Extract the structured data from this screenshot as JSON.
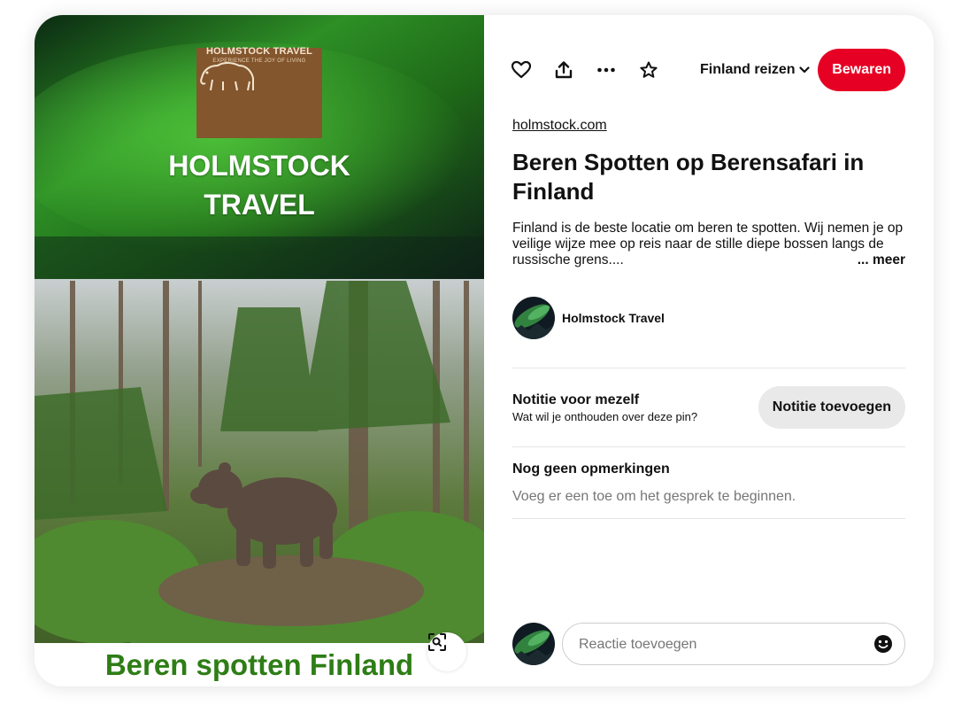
{
  "image": {
    "logo_text": "HOLMSTOCK TRAVEL",
    "logo_tagline": "EXPERIENCE THE JOY OF LIVING",
    "banner_line1": "HOLMSTOCK",
    "banner_line2": "TRAVEL",
    "bottom_caption": "Beren spotten Finland",
    "visual_search_icon": "visual-search-icon"
  },
  "toolbar": {
    "like_icon": "heart-icon",
    "share_icon": "share-upload-icon",
    "more_icon": "ellipsis-icon",
    "favorite_icon": "star-icon",
    "board_name": "Finland reizen",
    "save_label": "Bewaren"
  },
  "pin": {
    "source": "holmstock.com",
    "title": "Beren Spotten op Berensafari in Finland",
    "description": "Finland is de beste locatie om beren te spotten. Wij nemen je op veilige wijze mee op reis naar de stille diepe bossen langs de russische grens....",
    "more_label": "... meer"
  },
  "creator": {
    "name": "Holmstock Travel"
  },
  "note": {
    "title": "Notitie voor mezelf",
    "subtitle": "Wat wil je onthouden over deze pin?",
    "button_label": "Notitie toevoegen"
  },
  "comments": {
    "title": "Nog geen opmerkingen",
    "empty_text": "Voeg er een toe om het gesprek te beginnen.",
    "input_placeholder": "Reactie toevoegen",
    "emoji_icon": "smiley-icon"
  },
  "colors": {
    "save_button": "#e60023",
    "caption_green": "#2e7d16",
    "logo_brown": "#84562e"
  }
}
